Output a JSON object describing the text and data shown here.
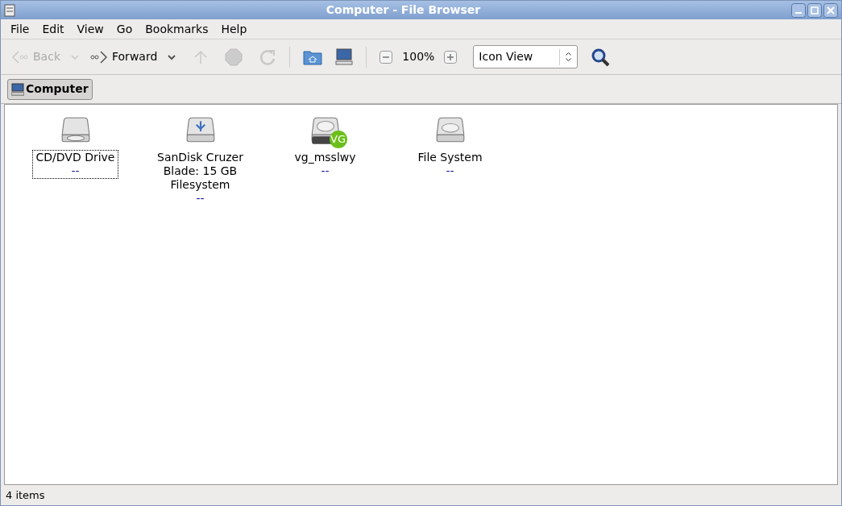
{
  "window": {
    "title": "Computer - File Browser"
  },
  "menu": [
    "File",
    "Edit",
    "View",
    "Go",
    "Bookmarks",
    "Help"
  ],
  "toolbar": {
    "back": {
      "label": "Back",
      "disabled": true
    },
    "forward": {
      "label": "Forward",
      "disabled": false
    },
    "up": {
      "disabled": true
    },
    "stop": {
      "disabled": true
    },
    "reload": {
      "disabled": true
    },
    "zoom": "100%",
    "view": "Icon View"
  },
  "location": {
    "label": "Computer"
  },
  "items": [
    {
      "kind": "optical",
      "name": "CD/DVD Drive",
      "info": "--",
      "focused": true
    },
    {
      "kind": "usb",
      "name": "SanDisk Cruzer Blade: 15 GB Filesystem",
      "info": "--",
      "focused": false
    },
    {
      "kind": "volume",
      "name": "vg_msslwy",
      "badge": "VG",
      "info": "--",
      "focused": false
    },
    {
      "kind": "harddisk",
      "name": "File System",
      "info": "--",
      "focused": false
    }
  ],
  "status_bar": "4 items"
}
